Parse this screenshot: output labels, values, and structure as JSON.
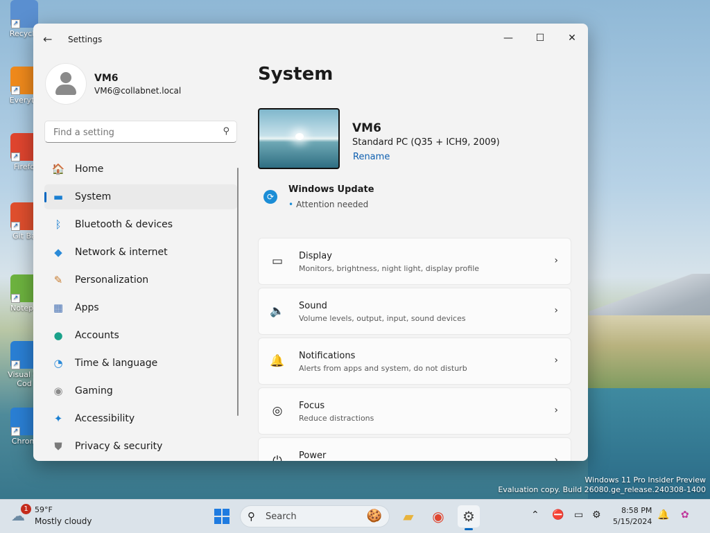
{
  "desktop": {
    "icons": [
      {
        "label": "Recycle",
        "color": "#5a8fd0"
      },
      {
        "label": "Everyth",
        "color": "#f08a1c"
      },
      {
        "label": "Firefo",
        "color": "#e0452f"
      },
      {
        "label": "Git Ba",
        "color": "#e04f2e"
      },
      {
        "label": "Notepa",
        "color": "#6db33f"
      },
      {
        "label": "Visual St\nCod",
        "color": "#2a7fd4"
      },
      {
        "label": "Chrom",
        "color": "#2a7fd4"
      }
    ]
  },
  "window": {
    "title": "Settings",
    "controls": {
      "minimize": "—",
      "maximize": "☐",
      "close": "✕"
    },
    "profile": {
      "name": "VM6",
      "email": "VM6@collabnet.local"
    },
    "search": {
      "placeholder": "Find a setting"
    },
    "nav": [
      {
        "label": "Home",
        "icon": "🏠",
        "color": "#d66a3b",
        "name": "home"
      },
      {
        "label": "System",
        "icon": "▬",
        "color": "#1a7fd1",
        "name": "system"
      },
      {
        "label": "Bluetooth & devices",
        "icon": "ᛒ",
        "color": "#1a7fd1",
        "name": "bluetooth-devices"
      },
      {
        "label": "Network & internet",
        "icon": "◆",
        "color": "#2a8ad8",
        "name": "network-internet"
      },
      {
        "label": "Personalization",
        "icon": "✎",
        "color": "#c77c30",
        "name": "personalization"
      },
      {
        "label": "Apps",
        "icon": "▦",
        "color": "#4a74b5",
        "name": "apps"
      },
      {
        "label": "Accounts",
        "icon": "●",
        "color": "#1aa18a",
        "name": "accounts"
      },
      {
        "label": "Time & language",
        "icon": "◔",
        "color": "#2a8ad8",
        "name": "time-language"
      },
      {
        "label": "Gaming",
        "icon": "◉",
        "color": "#8a8a8a",
        "name": "gaming"
      },
      {
        "label": "Accessibility",
        "icon": "✦",
        "color": "#1a7fd1",
        "name": "accessibility"
      },
      {
        "label": "Privacy & security",
        "icon": "⛊",
        "color": "#7a7a7a",
        "name": "privacy-security"
      }
    ],
    "active_nav": "System",
    "page_title": "System",
    "device": {
      "name": "VM6",
      "model": "Standard PC (Q35 + ICH9, 2009)",
      "rename": "Rename"
    },
    "windows_update": {
      "title": "Windows Update",
      "status": "Attention needed"
    },
    "cards": [
      {
        "title": "Display",
        "subtitle": "Monitors, brightness, night light, display profile",
        "icon": "▭",
        "name": "display"
      },
      {
        "title": "Sound",
        "subtitle": "Volume levels, output, input, sound devices",
        "icon": "🔈",
        "name": "sound"
      },
      {
        "title": "Notifications",
        "subtitle": "Alerts from apps and system, do not disturb",
        "icon": "🔔",
        "name": "notifications"
      },
      {
        "title": "Focus",
        "subtitle": "Reduce distractions",
        "icon": "◎",
        "name": "focus"
      },
      {
        "title": "Power",
        "subtitle": "",
        "icon": "⏻",
        "name": "power"
      }
    ]
  },
  "watermark": {
    "line1": "Windows 11 Pro Insider Preview",
    "line2": "Evaluation copy. Build 26080.ge_release.240308-1400"
  },
  "taskbar": {
    "weather": {
      "badge": "1",
      "temp": "59°F",
      "desc": "Mostly cloudy"
    },
    "search_label": "Search",
    "clock": {
      "time": "8:58 PM",
      "date": "5/15/2024"
    },
    "accent": "#0067c0"
  }
}
